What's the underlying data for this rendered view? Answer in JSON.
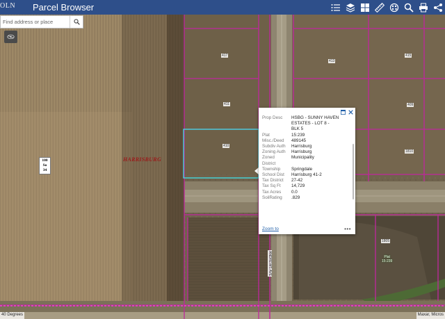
{
  "header": {
    "logo_text": "OLN",
    "title": "Parcel Browser",
    "background": "#2e4f8a",
    "tools": [
      {
        "name": "layer-list-icon"
      },
      {
        "name": "layers-icon"
      },
      {
        "name": "basemap-gallery-icon"
      },
      {
        "name": "measure-icon"
      },
      {
        "name": "draw-icon"
      },
      {
        "name": "search-icon"
      },
      {
        "name": "print-icon"
      },
      {
        "name": "share-icon"
      }
    ]
  },
  "search": {
    "placeholder": "Find address or place"
  },
  "map": {
    "town_label": "HARRISBURG",
    "shield_lines": [
      "100",
      "So",
      "34"
    ],
    "parcel_labels": [
      "417",
      "413",
      "415",
      "411",
      "409",
      "410",
      "1810",
      "1805"
    ],
    "road_label": "ANDREWS AVE",
    "plat_label": [
      "Plat",
      "15:239"
    ],
    "parcel_line_color": "#c0279e",
    "selected_parcel_color": "#3fe0e8"
  },
  "popup": {
    "rows": [
      {
        "k": "Prop Desc",
        "v": "HSBG - SUNNY HAVEN"
      },
      {
        "k": "",
        "v": "ESTATES - LOT 8 -"
      },
      {
        "k": "",
        "v": "BLK 5"
      },
      {
        "k": "Plat",
        "v": "15:239"
      },
      {
        "k": "Misc./Deed",
        "v": "489145"
      },
      {
        "k": "Subdiv Auth",
        "v": "Harrisburg"
      },
      {
        "k": "Zoning Auth",
        "v": "Harrisburg"
      },
      {
        "k": "Zoned",
        "v": "Municipality"
      },
      {
        "k": "District",
        "v": ""
      },
      {
        "k": "Township",
        "v": "Springdale"
      },
      {
        "k": "School Dist",
        "v": "Harrisburg 41-2"
      },
      {
        "k": "Tax District",
        "v": "27-42"
      },
      {
        "k": "Tax Sq Ft",
        "v": "14,729"
      },
      {
        "k": "Tax Acres",
        "v": "0.0"
      },
      {
        "k": "SoilRating",
        "v": ".829"
      }
    ],
    "zoom_label": "Zoom to",
    "more_label": "•••"
  },
  "footer": {
    "scale_text": "40 Degrees",
    "attribution": "Maxar, Micros"
  }
}
